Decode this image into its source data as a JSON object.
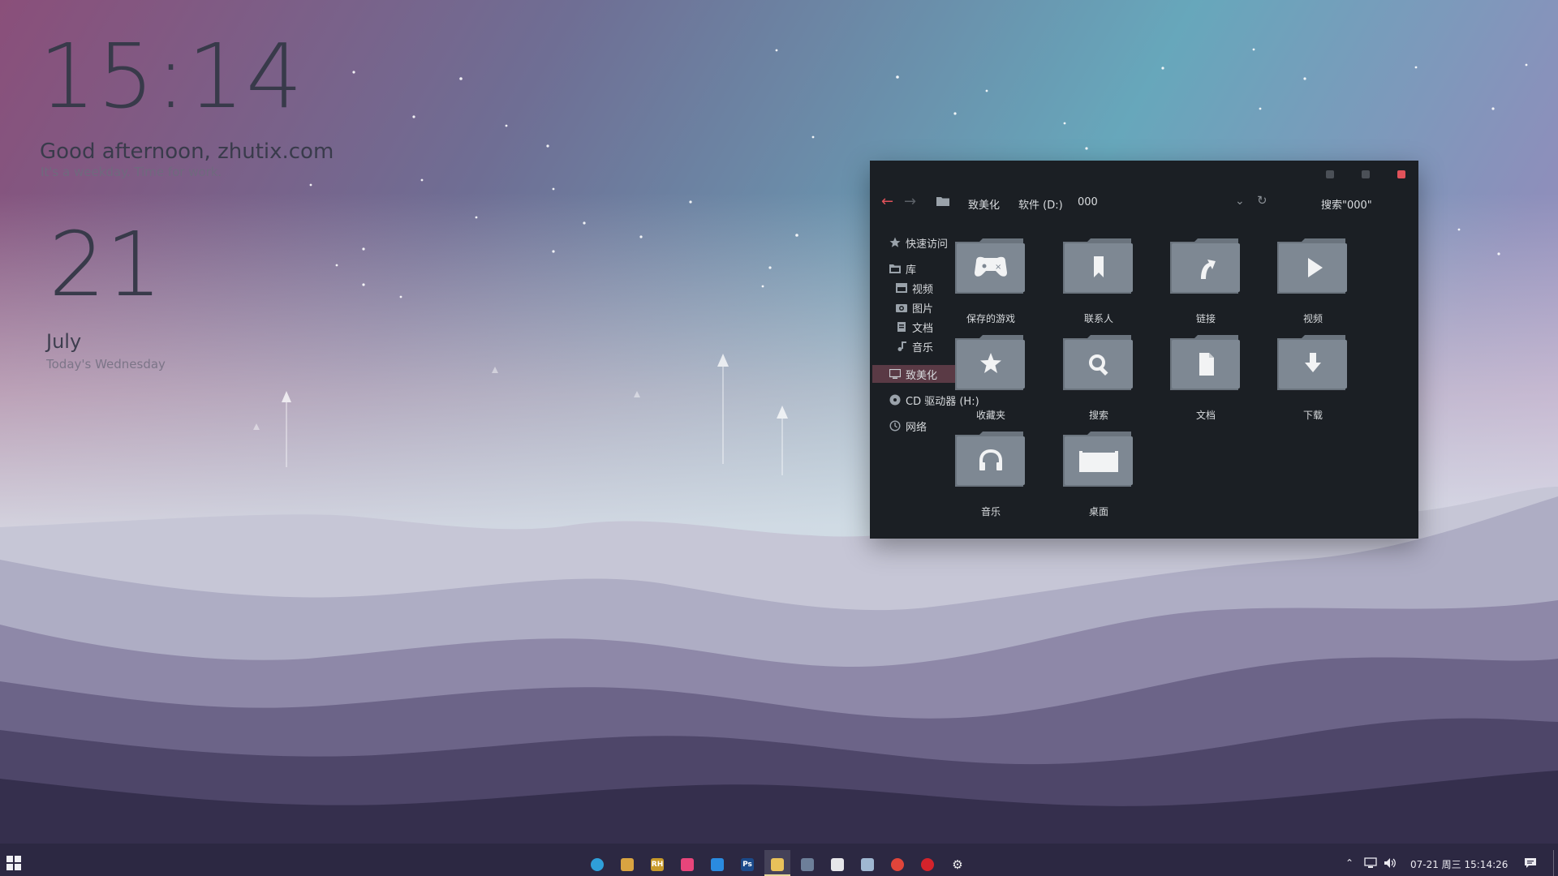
{
  "widgets": {
    "clock": "15:14",
    "greeting": "Good afternoon, zhutix.com",
    "greeting_sub": "It's a weekday. Time for work.",
    "day_number": "21",
    "month": "July",
    "weekday": "Today's Wednesday"
  },
  "explorer": {
    "breadcrumb": [
      "致美化",
      "软件 (D:)",
      "000"
    ],
    "search_text": "搜索\"000\"",
    "sidebar": {
      "quick_access": "快速访问",
      "library": "库",
      "videos": "视频",
      "pictures": "图片",
      "documents": "文档",
      "music": "音乐",
      "beautify": "致美化",
      "cd_drive": "CD 驱动器 (H:)",
      "network": "网络"
    },
    "folders": [
      {
        "label": "保存的游戏",
        "icon": "gamepad-icon"
      },
      {
        "label": "联系人",
        "icon": "bookmark-icon"
      },
      {
        "label": "链接",
        "icon": "link-arrow-icon"
      },
      {
        "label": "视频",
        "icon": "play-icon"
      },
      {
        "label": "收藏夹",
        "icon": "star-icon"
      },
      {
        "label": "搜索",
        "icon": "search-icon"
      },
      {
        "label": "文档",
        "icon": "document-icon"
      },
      {
        "label": "下载",
        "icon": "download-icon"
      },
      {
        "label": "音乐",
        "icon": "headphones-icon"
      },
      {
        "label": "桌面",
        "icon": "desktop-icon"
      }
    ]
  },
  "taskbar": {
    "apps": [
      {
        "name": "edge-icon",
        "text": "",
        "color": "#2f9fd9"
      },
      {
        "name": "tools-icon",
        "text": "",
        "color": "#d9a441"
      },
      {
        "name": "rh-icon",
        "text": "RH",
        "color": "#c89a2a"
      },
      {
        "name": "screenshot-icon",
        "text": "",
        "color": "#e8457b"
      },
      {
        "name": "writer-icon",
        "text": "",
        "color": "#2a8be0"
      },
      {
        "name": "photoshop-icon",
        "text": "Ps",
        "color": "#1b4a8a"
      },
      {
        "name": "file-explorer-icon",
        "text": "",
        "color": "#e8c15a"
      },
      {
        "name": "calculator-icon",
        "text": "",
        "color": "#6d7f99"
      },
      {
        "name": "notepad-icon",
        "text": "",
        "color": "#e6e6ea"
      },
      {
        "name": "files-icon",
        "text": "",
        "color": "#9fb7d1"
      },
      {
        "name": "chrome-icon",
        "text": "",
        "color": "#e0453a"
      },
      {
        "name": "netease-music-icon",
        "text": "",
        "color": "#d4232b"
      },
      {
        "name": "settings-icon",
        "text": "",
        "color": "#f0f0f0"
      }
    ],
    "datetime": "07-21 周三 15:14:26"
  },
  "colors": {
    "accent": "#e0525a",
    "window_bg": "#1b1f24",
    "folder": "#7e8893"
  }
}
